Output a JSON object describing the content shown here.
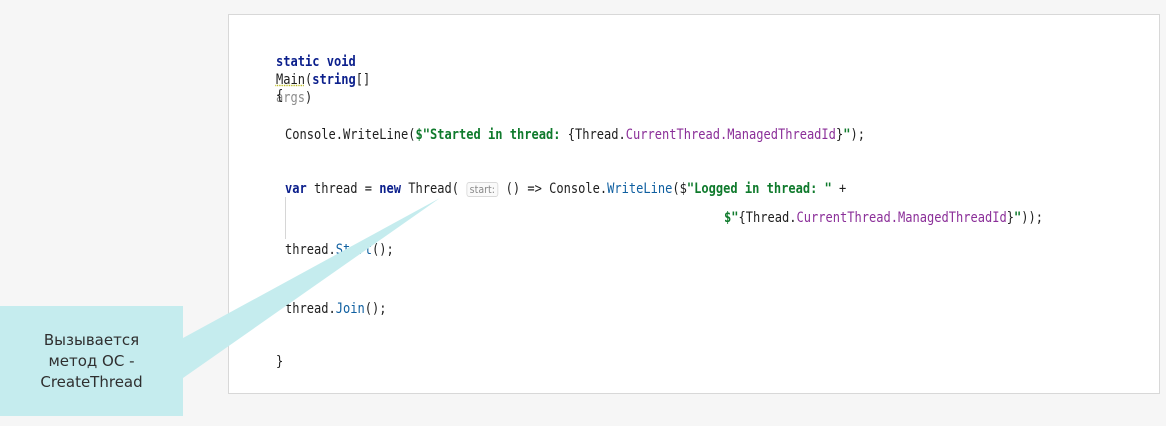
{
  "code": {
    "l1_kw": "static void",
    "l1_main": "Main",
    "l1_paren": "(",
    "l1_string": "string",
    "l1_brack": "[]",
    "l1_args": "args",
    "l1_close": ")",
    "l2": "{",
    "l3_pre": "Console.WriteLine(",
    "l3_str1": "$\"Started in thread: ",
    "l3_brace_open": "{",
    "l3_thread": "Thread.",
    "l3_prop": "CurrentThread.ManagedThreadId",
    "l3_brace_close": "}",
    "l3_str2": "\"",
    "l3_end": ");",
    "l4_var": "var",
    "l4_mid1": " thread = ",
    "l4_new": "new",
    "l4_mid2": " Thread( ",
    "l4_hint": "start:",
    "l4_mid3": " () => Console.",
    "l4_method": "WriteLine",
    "l4_paren": "(",
    "l4_dollar": "$",
    "l4_str": "\"Logged in thread: \"",
    "l4_plus": " +",
    "l5_dollar": "$",
    "l5_q": "\"",
    "l5_brace_open": "{",
    "l5_thread": "Thread.",
    "l5_prop": "CurrentThread.ManagedThreadId",
    "l5_brace_close": "}",
    "l5_q2": "\"",
    "l5_end": "));",
    "l6_obj": "thread.",
    "l6_method": "Start",
    "l6_end": "();",
    "l7_obj": "thread.",
    "l7_method": "Join",
    "l7_end": "();",
    "l8": "}"
  },
  "callout": {
    "text": "Вызывается\nметод ОС -\nCreateThread"
  },
  "colors": {
    "keyword": "#0b1f8c",
    "string": "#0f7a2c",
    "property": "#8b2f99",
    "callout_bg": "#c5ecee"
  }
}
